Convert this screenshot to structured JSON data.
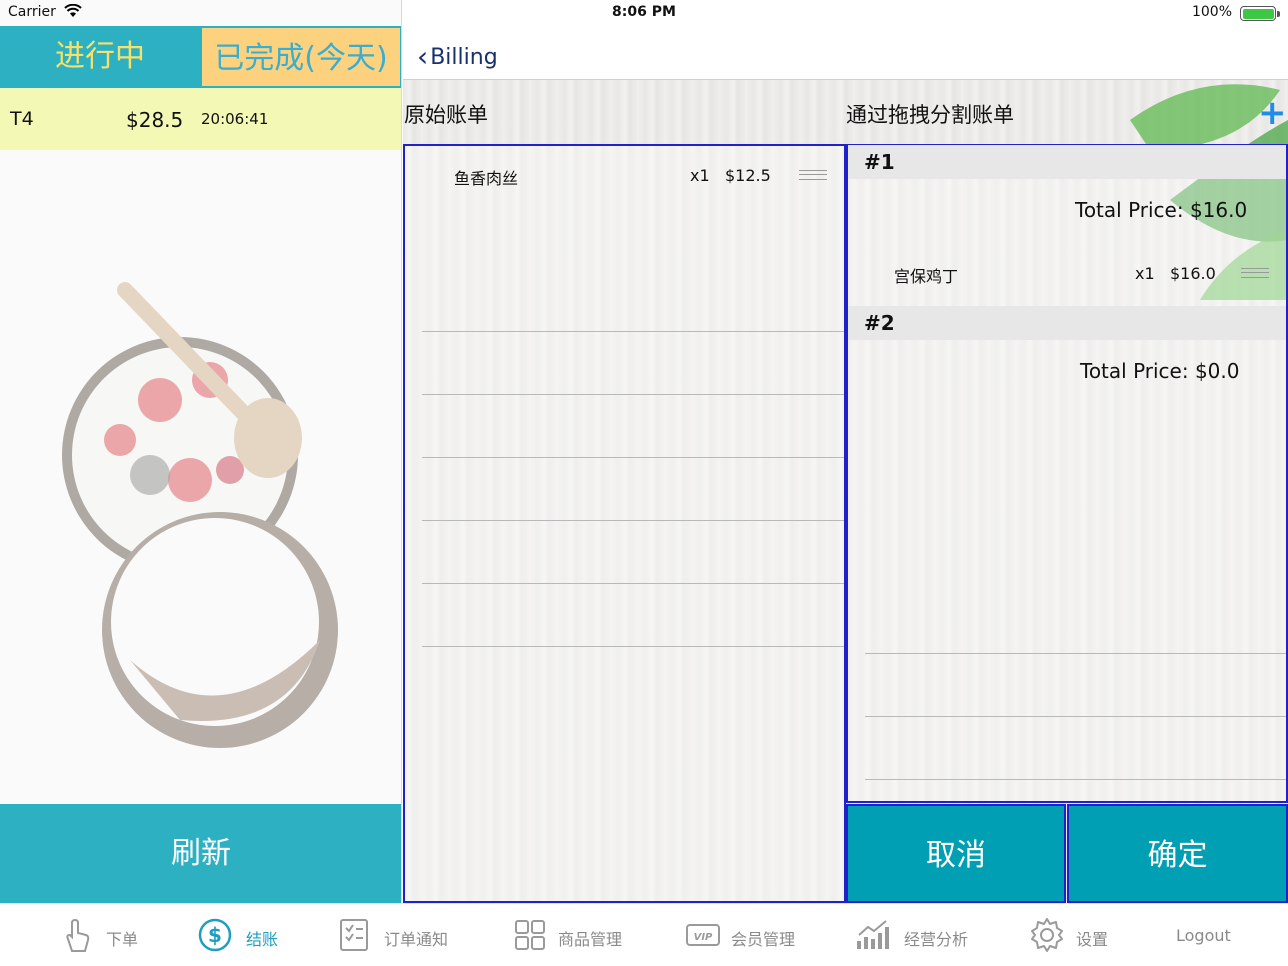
{
  "status_bar": {
    "carrier": "Carrier",
    "time": "8:06 PM",
    "battery": "100%"
  },
  "left": {
    "tabs": {
      "in_progress": "进行中",
      "completed": "已完成(今天)"
    },
    "orders": [
      {
        "table": "T4",
        "amount": "$28.5",
        "time": "20:06:41"
      }
    ],
    "refresh_label": "刷新"
  },
  "nav": {
    "back_label": "Billing"
  },
  "original_bill": {
    "title": "原始账单",
    "items": [
      {
        "name": "鱼香肉丝",
        "qty": "x1",
        "price": "$12.5"
      }
    ]
  },
  "split_bill": {
    "title": "通过拖拽分割账单",
    "add_icon": "plus-icon",
    "groups": [
      {
        "label": "#1",
        "total": "Total Price: $16.0",
        "items": [
          {
            "name": "宫保鸡丁",
            "qty": "x1",
            "price": "$16.0"
          }
        ]
      },
      {
        "label": "#2",
        "total": "Total Price: $0.0",
        "items": []
      }
    ]
  },
  "actions": {
    "cancel": "取消",
    "confirm": "确定"
  },
  "tabbar": [
    {
      "label": "下单",
      "icon": "hand-tap-icon"
    },
    {
      "label": "结账",
      "icon": "dollar-circle-icon",
      "active": true
    },
    {
      "label": "订单通知",
      "icon": "checklist-icon"
    },
    {
      "label": "商品管理",
      "icon": "grid-icon"
    },
    {
      "label": "会员管理",
      "icon": "vip-card-icon"
    },
    {
      "label": "经营分析",
      "icon": "chart-icon"
    },
    {
      "label": "设置",
      "icon": "gear-icon"
    },
    {
      "label": "Logout",
      "icon": ""
    }
  ],
  "colors": {
    "teal": "#2eb0c3",
    "button_teal": "#009fb3",
    "accent_yellow": "#fcd27e",
    "row_highlight": "#f3f9b5",
    "drop_border": "#2121c9",
    "plus_blue": "#1f8ce8"
  }
}
